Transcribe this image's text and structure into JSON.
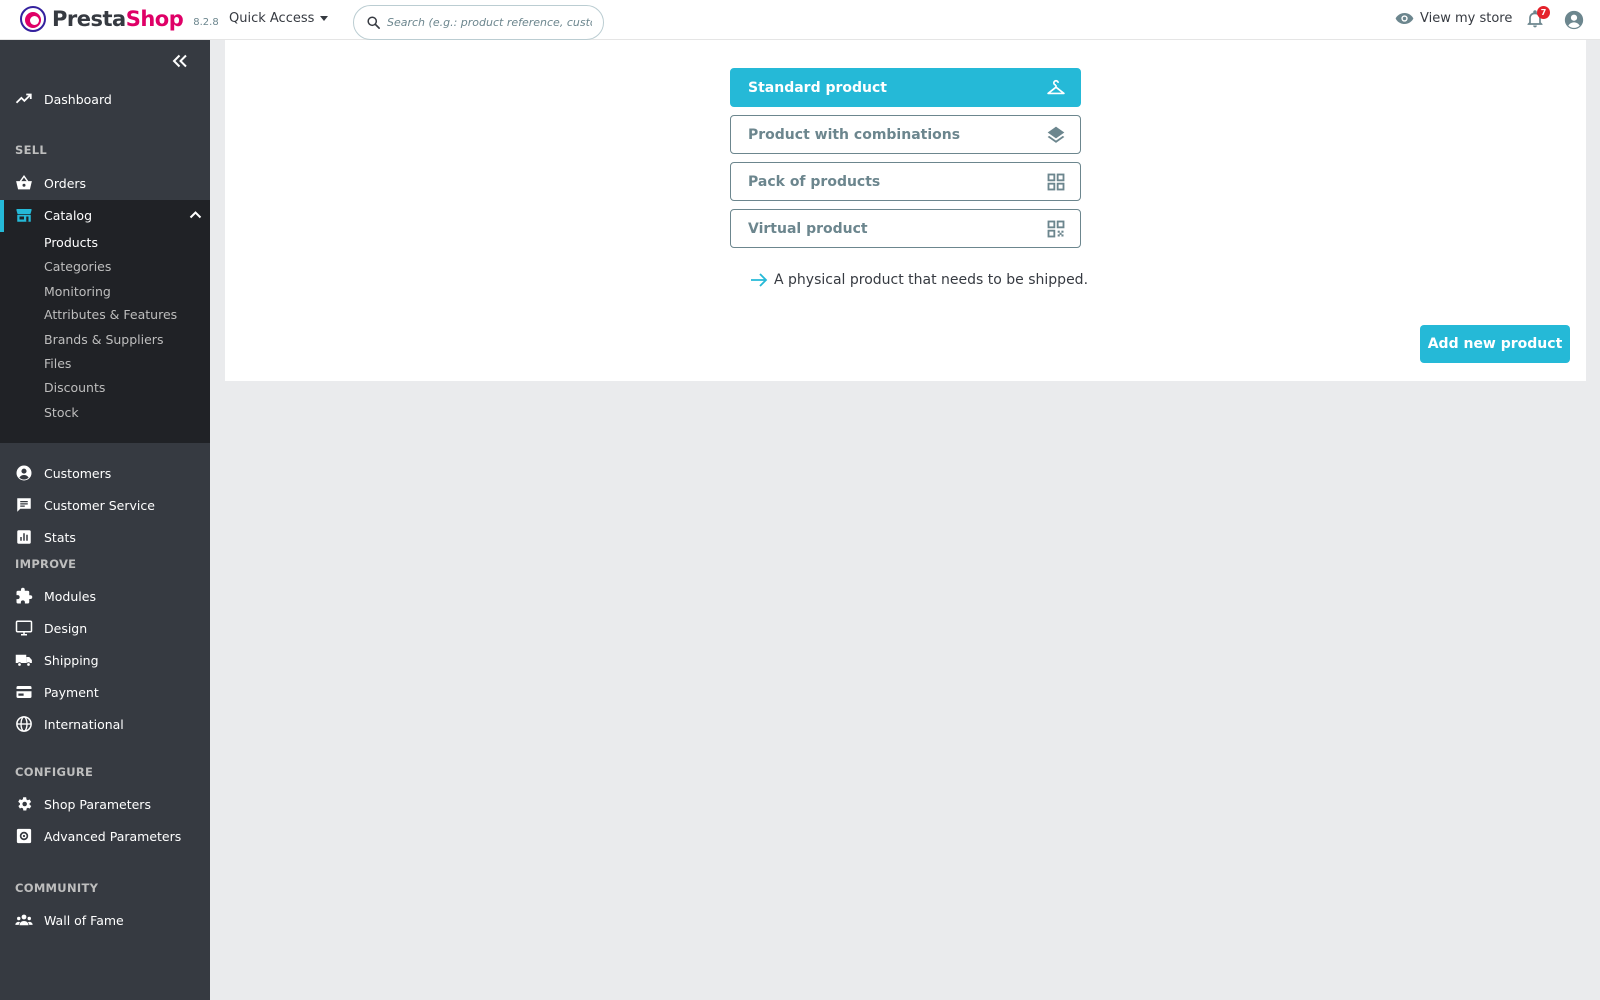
{
  "header": {
    "logo_presta": "Presta",
    "logo_shop": "Shop",
    "version": "8.2.8",
    "quick_access": "Quick Access",
    "search_placeholder": "Search (e.g.: product reference, custon",
    "view_store": "View my store",
    "notification_count": "7"
  },
  "sidebar": {
    "dashboard": "Dashboard",
    "sections": {
      "sell": "SELL",
      "improve": "IMPROVE",
      "configure": "CONFIGURE",
      "community": "COMMUNITY"
    },
    "orders": "Orders",
    "catalog": "Catalog",
    "catalog_sub": [
      "Products",
      "Categories",
      "Monitoring",
      "Attributes & Features",
      "Brands & Suppliers",
      "Files",
      "Discounts",
      "Stock"
    ],
    "customers": "Customers",
    "customer_service": "Customer Service",
    "stats": "Stats",
    "modules": "Modules",
    "design": "Design",
    "shipping": "Shipping",
    "payment": "Payment",
    "international": "International",
    "shop_parameters": "Shop Parameters",
    "advanced_parameters": "Advanced Parameters",
    "wall_of_fame": "Wall of Fame"
  },
  "product_types": [
    {
      "label": "Standard product",
      "icon": "hanger-icon",
      "selected": true
    },
    {
      "label": "Product with combinations",
      "icon": "layers-icon",
      "selected": false
    },
    {
      "label": "Pack of products",
      "icon": "grid-icon",
      "selected": false
    },
    {
      "label": "Virtual product",
      "icon": "qr-code-icon",
      "selected": false
    }
  ],
  "description": "A physical product that needs to be shipped.",
  "add_button": "Add new product",
  "colors": {
    "accent": "#25b9d7",
    "sidebar_bg": "#363a41",
    "sidebar_active_bg": "#202226",
    "brand_pink": "#df0067",
    "badge_red": "#e4222b"
  }
}
